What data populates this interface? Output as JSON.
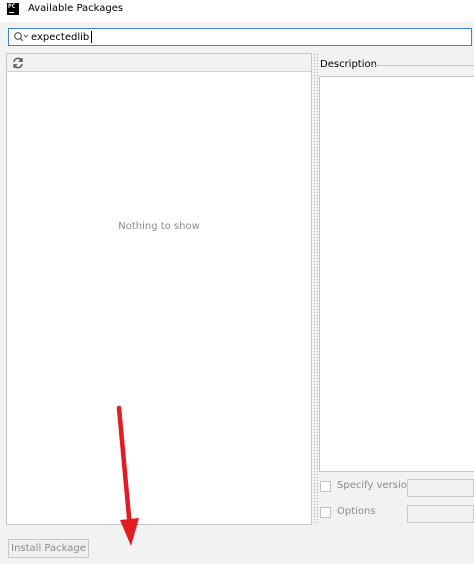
{
  "window": {
    "title": "Available Packages",
    "app_icon_text": "PC"
  },
  "search": {
    "value": "expectedlib",
    "icon": "search-icon"
  },
  "package_list": {
    "refresh_icon": "refresh-icon",
    "empty_text": "Nothing to show"
  },
  "description": {
    "label": "Description"
  },
  "options": {
    "specify_version_label": "Specify version",
    "specify_version_checked": false,
    "options_label": "Options",
    "options_checked": false
  },
  "actions": {
    "install_label": "Install Package",
    "install_enabled": false
  },
  "annotation": {
    "arrow_color": "#e31b23"
  },
  "colors": {
    "focus_border": "#3d83d8",
    "disabled_text": "#8c8c8c"
  }
}
